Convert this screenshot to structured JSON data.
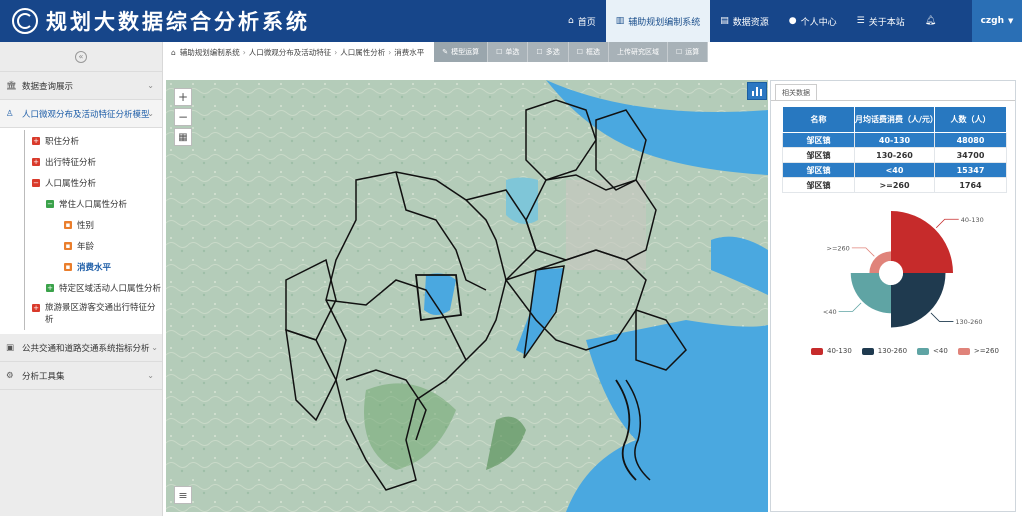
{
  "header": {
    "title": "规划大数据综合分析系统",
    "nav": [
      {
        "icon": "home-icon",
        "label": "首页"
      },
      {
        "icon": "chart-icon",
        "label": "辅助规划编制系统"
      },
      {
        "icon": "database-icon",
        "label": "数据资源"
      },
      {
        "icon": "user-icon",
        "label": "个人中心"
      },
      {
        "icon": "list-icon",
        "label": "关于本站"
      },
      {
        "icon": "bell-icon",
        "label": ""
      }
    ],
    "user": "czgh"
  },
  "sidebar": {
    "menus": [
      {
        "label": "数据查询展示"
      },
      {
        "label": "人口微观分布及活动特征分析模型"
      },
      {
        "label": "公共交通和道路交通系统指标分析"
      },
      {
        "label": "分析工具集"
      }
    ],
    "tree": {
      "job": "职住分析",
      "trip": "出行特征分析",
      "pop_attr": "人口属性分析",
      "resident": "常住人口属性分析",
      "gender": "性别",
      "age": "年龄",
      "consume": "消费水平",
      "special_area": "特定区域活动人口属性分析",
      "tourism": "旅游景区游客交通出行特征分析"
    }
  },
  "breadcrumb": [
    "辅助规划编制系统",
    "人口微观分布及活动特征",
    "人口属性分析",
    "消费水平"
  ],
  "toolbar": [
    "模型运算",
    "单选",
    "多选",
    "框选",
    "上传研究区域",
    "运算"
  ],
  "panel": {
    "tab": "相关数据",
    "table": {
      "headers": [
        "名称",
        "月均话费消费（人/元）",
        "人数（人）"
      ],
      "rows": [
        {
          "name": "邹区镇",
          "range": "40-130",
          "count": "48080"
        },
        {
          "name": "邹区镇",
          "range": "130-260",
          "count": "34700"
        },
        {
          "name": "邹区镇",
          "range": "<40",
          "count": "15347"
        },
        {
          "name": "邹区镇",
          "range": ">=260",
          "count": "1764"
        }
      ]
    }
  },
  "chart_data": {
    "type": "pie",
    "subtype": "rose",
    "categories": [
      "40-130",
      "130-260",
      "<40",
      ">=260"
    ],
    "values": [
      48080,
      34700,
      15347,
      1764
    ],
    "colors": [
      "#c62b2b",
      "#1f3a4f",
      "#5fa4a4",
      "#e0837a"
    ],
    "legend": "bottom",
    "slice_labels": [
      "40-130",
      "130-260",
      "<40",
      ">=260"
    ]
  },
  "map_controls": {
    "zoom_in": "+",
    "zoom_out": "−",
    "layers": "▦",
    "menu": "≡"
  }
}
